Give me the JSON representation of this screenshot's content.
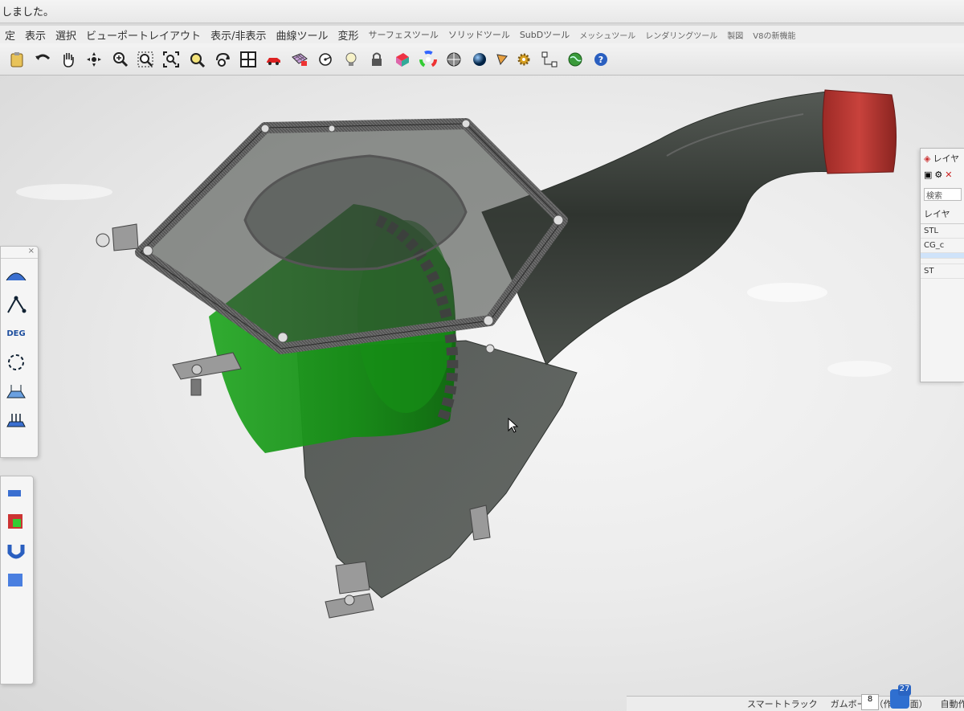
{
  "status": {
    "message": "しました。"
  },
  "menu": {
    "items": [
      {
        "label": "定",
        "size": "normal"
      },
      {
        "label": "表示",
        "size": "normal"
      },
      {
        "label": "選択",
        "size": "normal"
      },
      {
        "label": "ビューポートレイアウト",
        "size": "normal"
      },
      {
        "label": "表示/非表示",
        "size": "normal"
      },
      {
        "label": "曲線ツール",
        "size": "normal"
      },
      {
        "label": "変形",
        "size": "normal"
      },
      {
        "label": "サーフェスツール",
        "size": "small"
      },
      {
        "label": "ソリッドツール",
        "size": "small"
      },
      {
        "label": "SubDツール",
        "size": "small"
      },
      {
        "label": "メッシュツール",
        "size": "tiny"
      },
      {
        "label": "レンダリングツール",
        "size": "tiny"
      },
      {
        "label": "製図",
        "size": "tiny"
      },
      {
        "label": "V8の新機能",
        "size": "tiny"
      }
    ]
  },
  "toolbar": {
    "icons": [
      "clipboard-icon",
      "undo-icon",
      "pan-hand-icon",
      "rotate-view-icon",
      "zoom-icon",
      "zoom-window-icon",
      "zoom-extents-icon",
      "zoom-selected-icon",
      "rotate-camera-icon",
      "four-viewports-icon",
      "car-icon",
      "grid-texture-icon",
      "circle-point-icon",
      "light-bulb-icon",
      "lock-icon",
      "object-props-icon",
      "color-wheel-icon",
      "sphere-gray-icon",
      "sphere-blue-icon",
      "cone-icon",
      "gear-icon",
      "group-icon",
      "globe-icon",
      "help-icon"
    ]
  },
  "left_palette": {
    "deg_label": "DEG"
  },
  "layer_panel": {
    "title": "レイヤ",
    "search_placeholder": "検索",
    "header": "レイヤ",
    "rows": [
      {
        "label": "STL",
        "selected": false
      },
      {
        "label": "CG_c",
        "selected": false
      },
      {
        "label": "",
        "selected": true
      },
      {
        "label": "",
        "selected": false
      },
      {
        "label": "ST",
        "selected": false
      }
    ]
  },
  "bottom_bar": {
    "smart_track": "スマートトラック",
    "gumball": "ガムボール（作業平面）",
    "auto_save": "自動作業"
  },
  "tray": {
    "badge_count": "27",
    "small_count": "8"
  },
  "colors": {
    "filter_green": "#1f9a1f",
    "outlet_red": "#b8332e",
    "tube_dark": "#3a3f3a",
    "frame_carbon": "#5a5a5a"
  }
}
